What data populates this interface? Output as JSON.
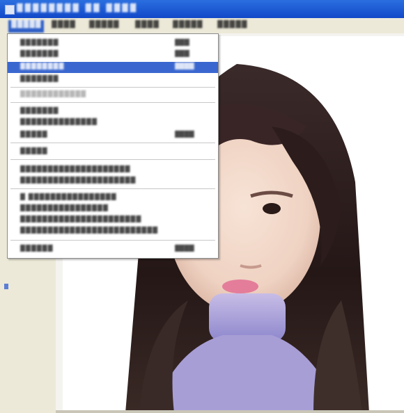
{
  "window": {
    "title": "▓▓▓▓▓▓▓▓ ▓▓ ▓▓▓▓",
    "icon": "app-icon"
  },
  "menubar": {
    "items": [
      {
        "label": "▓▓▓▓▓",
        "active": true
      },
      {
        "label": "▓▓▓▓"
      },
      {
        "label": "▓▓▓▓▓"
      },
      {
        "label": "▓▓▓▓"
      },
      {
        "label": "▓▓▓▓▓"
      },
      {
        "label": "▓▓▓▓▓"
      }
    ]
  },
  "dropdown": {
    "items": [
      {
        "label": "▓▓▓▓▓▓▓",
        "shortcut": "▓▓▓"
      },
      {
        "label": "▓▓▓▓▓▓▓",
        "shortcut": "▓▓▓"
      },
      {
        "label": "▓▓▓▓▓▓▓▓",
        "shortcut": "▓▓▓▓",
        "highlighted": true
      },
      {
        "label": "▓▓▓▓▓▓▓"
      },
      {
        "label": "▓▓▓▓▓▓▓▓▓▓▓▓",
        "disabled": true
      },
      {
        "label": "▓▓▓▓▓▓▓"
      },
      {
        "label": "▓▓▓▓▓▓▓▓▓▓▓▓▓▓"
      },
      {
        "label": "▓▓▓▓▓",
        "shortcut": "▓▓▓▓"
      },
      {
        "label": "▓▓▓▓▓"
      },
      {
        "label": "▓▓▓▓▓▓▓▓▓▓▓▓▓▓▓▓▓▓▓▓"
      },
      {
        "label": "▓▓▓▓▓▓▓▓▓▓▓▓▓▓▓▓▓▓▓▓▓"
      },
      {
        "label": "▓ ▓▓▓▓▓▓▓▓▓▓▓▓▓▓▓▓"
      },
      {
        "label": "▓▓▓▓▓▓▓▓▓▓▓▓▓▓▓▓"
      },
      {
        "label": "▓▓▓▓▓▓▓▓▓▓▓▓▓▓▓▓▓▓▓▓▓▓"
      },
      {
        "label": "▓▓▓▓▓▓▓▓▓▓▓▓▓▓▓▓▓▓▓▓▓▓▓▓▓"
      },
      {
        "label": "▓▓▓▓▓▓",
        "shortcut": "▓▓▓▓"
      }
    ]
  },
  "colors": {
    "titlebar": "#1a56d6",
    "menu_highlight": "#3a67cf",
    "window_face": "#ece9d8"
  }
}
